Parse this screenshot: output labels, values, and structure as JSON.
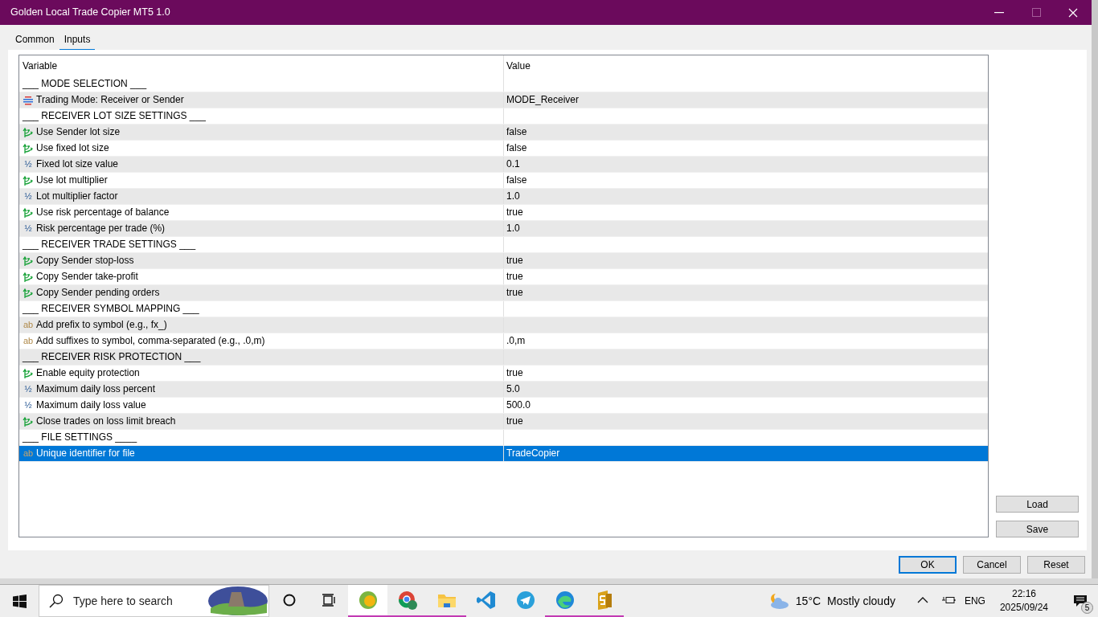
{
  "window": {
    "title": "Golden Local Trade Copier MT5 1.0"
  },
  "tabs": [
    {
      "label": "Common",
      "selected": false
    },
    {
      "label": "Inputs",
      "selected": true
    }
  ],
  "table": {
    "columns": [
      "Variable",
      "Value"
    ],
    "rows": [
      {
        "kind": "section",
        "variable": "___ MODE SELECTION ___",
        "selected": false
      },
      {
        "kind": "enum",
        "variable": "Trading Mode: Receiver or Sender",
        "value": "MODE_Receiver",
        "selected": false
      },
      {
        "kind": "section",
        "variable": "___ RECEIVER LOT SIZE SETTINGS ___",
        "selected": false
      },
      {
        "kind": "bool",
        "variable": "Use Sender lot size",
        "value": "false",
        "selected": false
      },
      {
        "kind": "bool",
        "variable": "Use fixed lot size",
        "value": "false",
        "selected": false
      },
      {
        "kind": "number",
        "glyph": "½",
        "variable": "Fixed lot size value",
        "value": "0.1",
        "selected": false
      },
      {
        "kind": "bool",
        "variable": "Use lot multiplier",
        "value": "false",
        "selected": false
      },
      {
        "kind": "number",
        "glyph": "½",
        "variable": "Lot multiplier factor",
        "value": "1.0",
        "selected": false
      },
      {
        "kind": "bool",
        "variable": "Use risk percentage of balance",
        "value": "true",
        "selected": false
      },
      {
        "kind": "number",
        "glyph": "½",
        "variable": "Risk percentage per trade (%)",
        "value": "1.0",
        "selected": false
      },
      {
        "kind": "section",
        "variable": "___ RECEIVER TRADE SETTINGS ___",
        "selected": false
      },
      {
        "kind": "bool",
        "variable": "Copy Sender stop-loss",
        "value": "true",
        "selected": false
      },
      {
        "kind": "bool",
        "variable": "Copy Sender take-profit",
        "value": "true",
        "selected": false
      },
      {
        "kind": "bool",
        "variable": "Copy Sender pending orders",
        "value": "true",
        "selected": false
      },
      {
        "kind": "section",
        "variable": "___ RECEIVER SYMBOL MAPPING ___",
        "selected": false
      },
      {
        "kind": "string",
        "glyph": "ab",
        "variable": "Add prefix to symbol (e.g., fx_)",
        "selected": false
      },
      {
        "kind": "string",
        "glyph": "ab",
        "variable": "Add suffixes to symbol, comma-separated (e.g., .0,m)",
        "value": ".0,m",
        "selected": false
      },
      {
        "kind": "section",
        "variable": "___ RECEIVER RISK PROTECTION ___",
        "selected": false
      },
      {
        "kind": "bool",
        "variable": "Enable equity protection",
        "value": "true",
        "selected": false
      },
      {
        "kind": "number",
        "glyph": "½",
        "variable": "Maximum daily loss percent",
        "value": "5.0",
        "selected": false
      },
      {
        "kind": "number",
        "glyph": "½",
        "variable": "Maximum daily loss value",
        "value": "500.0",
        "selected": false
      },
      {
        "kind": "bool",
        "variable": "Close trades on loss limit breach",
        "value": "true",
        "selected": false
      },
      {
        "kind": "section",
        "variable": "___ FILE SETTINGS ____",
        "selected": false
      },
      {
        "kind": "string",
        "glyph": "ab",
        "variable": "Unique identifier for file",
        "value": "TradeCopier",
        "selected": true
      }
    ]
  },
  "side_buttons": [
    "Load",
    "Save"
  ],
  "buttons": [
    {
      "label": "OK",
      "default": true
    },
    {
      "label": "Cancel",
      "default": false
    },
    {
      "label": "Reset",
      "default": false
    }
  ],
  "taskbar": {
    "search": {
      "placeholder": "Type here to search"
    },
    "apps": [
      {
        "kind": "mt5",
        "running": true,
        "active": true
      },
      {
        "kind": "chrome",
        "running": true,
        "active": false
      },
      {
        "kind": "folder",
        "running": true,
        "active": false
      },
      {
        "kind": "vscode",
        "running": false,
        "active": false
      },
      {
        "kind": "telegram",
        "running": false,
        "active": false
      },
      {
        "kind": "edge",
        "running": true,
        "active": false
      },
      {
        "kind": "mt5b",
        "running": true,
        "active": false
      }
    ],
    "weather": {
      "temperature": "15°C",
      "condition": "Mostly cloudy"
    },
    "language": "ENG",
    "time": "22:16",
    "date": "2025/09/24",
    "notifications": "5"
  }
}
